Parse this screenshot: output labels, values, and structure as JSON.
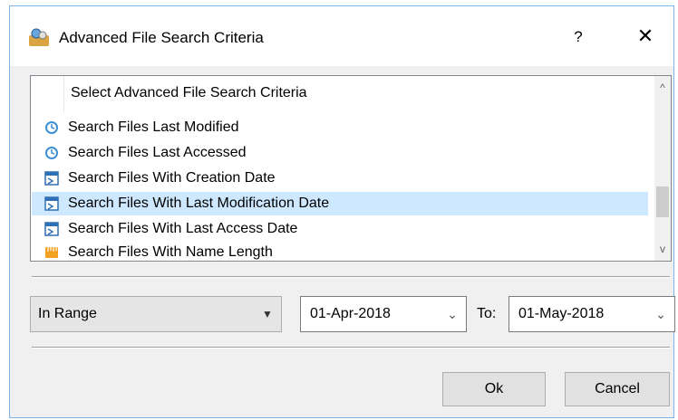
{
  "window": {
    "title": "Advanced File Search Criteria",
    "help_label": "?",
    "close_label": "✕"
  },
  "list": {
    "header": "Select Advanced File Search Criteria",
    "items": [
      {
        "label": "Search Files Last Modified",
        "icon": "clock-icon"
      },
      {
        "label": "Search Files Last Accessed",
        "icon": "clock-icon"
      },
      {
        "label": "Search Files With Creation Date",
        "icon": "calendar-icon"
      },
      {
        "label": "Search Files With Last Modification Date",
        "icon": "calendar-icon",
        "selected": true
      },
      {
        "label": "Search Files With Last Access Date",
        "icon": "calendar-icon"
      },
      {
        "label": "Search Files With Name Length",
        "icon": "ruler-icon"
      }
    ],
    "scroll_up": "^",
    "scroll_down": "v"
  },
  "criteria": {
    "range_mode": "In Range",
    "from_date": "01-Apr-2018",
    "to_label": "To:",
    "to_date": "01-May-2018"
  },
  "buttons": {
    "ok": "Ok",
    "cancel": "Cancel"
  },
  "colors": {
    "selection": "#cde8ff",
    "window_border": "#7eb4ea",
    "dialog_bg": "#f0f0f0"
  }
}
